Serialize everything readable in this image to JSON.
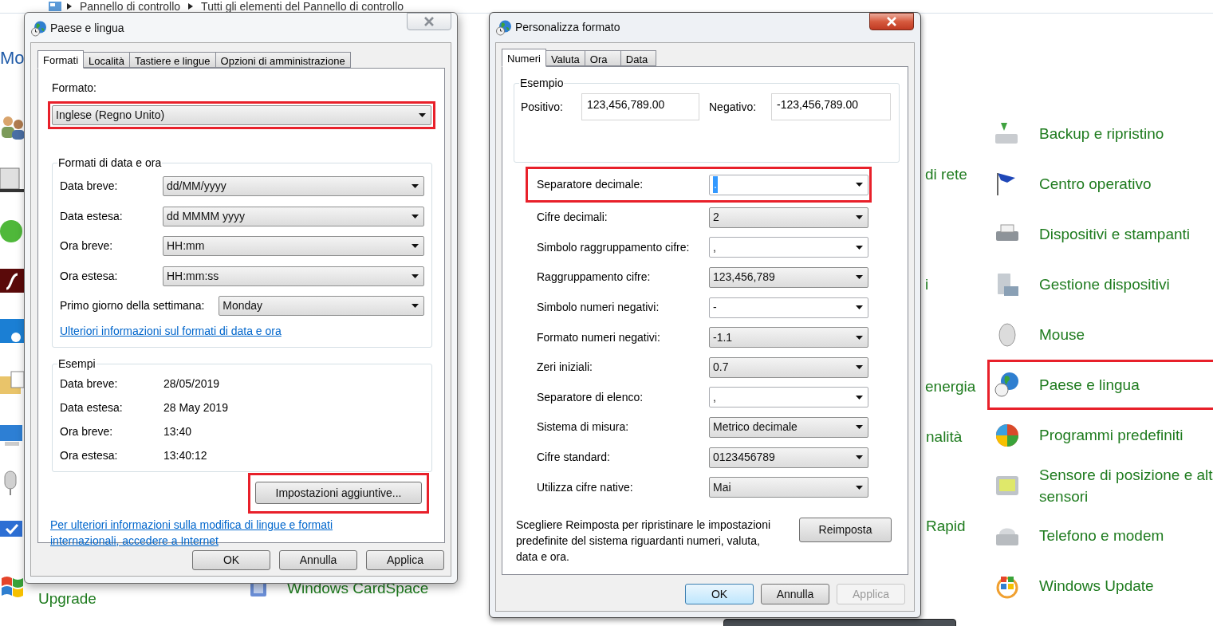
{
  "breadcrumb": [
    "Pannello di controllo",
    "Tutti gli elementi del Pannello di controllo"
  ],
  "background_fragments": [
    {
      "text": "Mo",
      "kind": "heading"
    },
    {
      "text": "Upgrade",
      "kind": "item"
    },
    {
      "text": "Windows CardSpace",
      "kind": "item"
    },
    {
      "text": "di rete",
      "kind": "item"
    },
    {
      "text": "i",
      "kind": "item"
    },
    {
      "text": "energia",
      "kind": "item"
    },
    {
      "text": "nalità",
      "kind": "item"
    },
    {
      "text": "Rapid",
      "kind": "item"
    }
  ],
  "control_panel_items": [
    {
      "label": "Backup e ripristino",
      "highlighted": false
    },
    {
      "label": "Centro operativo",
      "highlighted": false
    },
    {
      "label": "Dispositivi e stampanti",
      "highlighted": false
    },
    {
      "label": "Gestione dispositivi",
      "highlighted": false
    },
    {
      "label": "Mouse",
      "highlighted": false
    },
    {
      "label": "Paese e lingua",
      "highlighted": true
    },
    {
      "label": "Programmi predefiniti",
      "highlighted": false
    },
    {
      "label": "Sensore di posizione e alt\nsensori",
      "highlighted": false
    },
    {
      "label": "Telefono e modem",
      "highlighted": false
    },
    {
      "label": "Windows Update",
      "highlighted": false
    }
  ],
  "region_dialog": {
    "title": "Paese e lingua",
    "active": false,
    "tabs": [
      {
        "label": "Formati",
        "selected": true
      },
      {
        "label": "Località",
        "selected": false
      },
      {
        "label": "Tastiere e lingue",
        "selected": false
      },
      {
        "label": "Opzioni di amministrazione",
        "selected": false
      }
    ],
    "format_label": "Formato:",
    "format": {
      "value": "Inglese (Regno Unito)",
      "highlighted": true
    },
    "date_group": {
      "title": "Formati di data e ora",
      "rows": [
        {
          "label": "Data breve:",
          "value": "dd/MM/yyyy"
        },
        {
          "label": "Data estesa:",
          "value": "dd MMMM yyyy"
        },
        {
          "label": "Ora breve:",
          "value": "HH:mm"
        },
        {
          "label": "Ora estesa:",
          "value": "HH:mm:ss"
        },
        {
          "label": "Primo giorno della settimana:",
          "value": "Monday"
        }
      ],
      "link": "Ulteriori informazioni sul formati di data e ora"
    },
    "examples": {
      "title": "Esempi",
      "rows": [
        {
          "label": "Data breve:",
          "value": "28/05/2019"
        },
        {
          "label": "Data estesa:",
          "value": "28 May 2019"
        },
        {
          "label": "Ora breve:",
          "value": "13:40"
        },
        {
          "label": "Ora estesa:",
          "value": "13:40:12"
        }
      ]
    },
    "more_button": {
      "label": "Impostazioni aggiuntive...",
      "highlighted": true
    },
    "footer_link": "Per ulteriori informazioni sulla modifica di lingue e formati\ninternazionali, accedere a Internet",
    "buttons": [
      {
        "label": "OK",
        "disabled": false,
        "default": false
      },
      {
        "label": "Annulla",
        "disabled": false,
        "default": false
      },
      {
        "label": "Applica",
        "disabled": false,
        "default": false
      }
    ]
  },
  "customize_dialog": {
    "title": "Personalizza formato",
    "active": true,
    "tabs": [
      {
        "label": "Numeri",
        "selected": true
      },
      {
        "label": "Valuta",
        "selected": false
      },
      {
        "label": "Ora",
        "selected": false
      },
      {
        "label": "Data",
        "selected": false
      }
    ],
    "example": {
      "title": "Esempio",
      "positive_label": "Positivo:",
      "positive": "123,456,789.00",
      "negative_label": "Negativo:",
      "negative": "-123,456,789.00"
    },
    "rows": [
      {
        "label": "Separatore decimale:",
        "value": ".",
        "kind": "editable",
        "highlighted": true,
        "text_selected": true
      },
      {
        "label": "Cifre decimali:",
        "value": "2",
        "kind": "list",
        "highlighted": false,
        "text_selected": false
      },
      {
        "label": "Simbolo raggruppamento cifre:",
        "value": ",",
        "kind": "editable",
        "highlighted": false,
        "text_selected": false
      },
      {
        "label": "Raggruppamento cifre:",
        "value": "123,456,789",
        "kind": "list",
        "highlighted": false,
        "text_selected": false
      },
      {
        "label": "Simbolo numeri negativi:",
        "value": "-",
        "kind": "editable",
        "highlighted": false,
        "text_selected": false
      },
      {
        "label": "Formato numeri negativi:",
        "value": "-1.1",
        "kind": "list",
        "highlighted": false,
        "text_selected": false
      },
      {
        "label": "Zeri iniziali:",
        "value": "0.7",
        "kind": "list",
        "highlighted": false,
        "text_selected": false
      },
      {
        "label": "Separatore di elenco:",
        "value": ",",
        "kind": "editable",
        "highlighted": false,
        "text_selected": false
      },
      {
        "label": "Sistema di misura:",
        "value": "Metrico decimale",
        "kind": "list",
        "highlighted": false,
        "text_selected": false
      },
      {
        "label": "Cifre standard:",
        "value": "0123456789",
        "kind": "list",
        "highlighted": false,
        "text_selected": false
      },
      {
        "label": "Utilizza cifre native:",
        "value": "Mai",
        "kind": "list",
        "highlighted": false,
        "text_selected": false
      }
    ],
    "reset_text": "Scegliere Reimposta per ripristinare le impostazioni predefinite del sistema riguardanti numeri, valuta, data e ora.",
    "reset_button": "Reimposta",
    "buttons": [
      {
        "label": "OK",
        "disabled": false,
        "default": true
      },
      {
        "label": "Annulla",
        "disabled": false,
        "default": false
      },
      {
        "label": "Applica",
        "disabled": true,
        "default": false
      }
    ]
  }
}
